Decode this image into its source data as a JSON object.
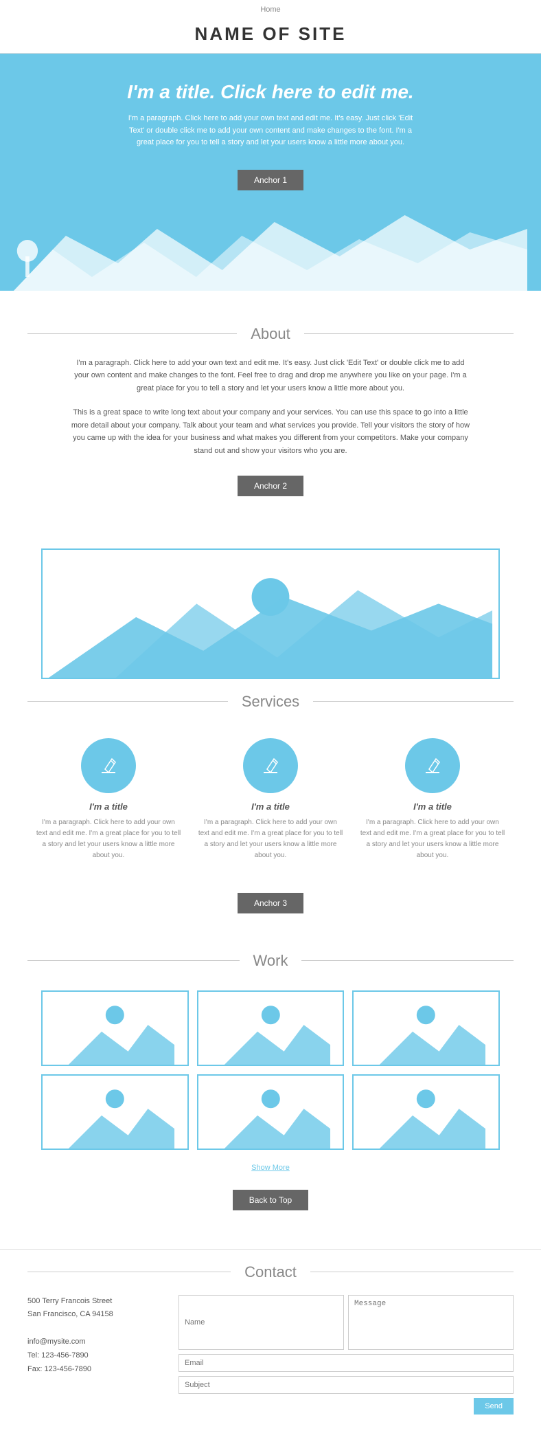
{
  "nav": {
    "home": "Home"
  },
  "header": {
    "title": "NAME OF SITE"
  },
  "hero": {
    "heading": "I'm a title. Click here to edit me.",
    "paragraph": "I'm a paragraph. Click here to add your own text and edit me. It's easy. Just click 'Edit Text' or double click me to add your own content and make changes to the font. I'm a great place for you to tell a story and let your users know a little more about you.",
    "button": "Anchor 1"
  },
  "about": {
    "section_title": "About",
    "paragraph1": "I'm a paragraph. Click here to add your own text and edit me. It's easy. Just click 'Edit Text' or double click me to add your own content and make changes to the font. Feel free to drag and drop me anywhere you like on your page. I'm a great place for you to tell a story and let your users know a little more about you.",
    "paragraph2": "This is a great space to write long text about your company and your services. You can use this space to go into a little more detail about your company. Talk about your team and what services you provide. Tell your visitors the story of how you came up with the idea for your business and what makes you different from your competitors. Make your company stand out and show your visitors who you are.",
    "button": "Anchor 2"
  },
  "services": {
    "section_title": "Services",
    "items": [
      {
        "title": "I'm a title",
        "paragraph": "I'm a paragraph. Click here to add your own text and edit me. I'm a great place for you to tell a story and let your users know a little more about you."
      },
      {
        "title": "I'm a title",
        "paragraph": "I'm a paragraph. Click here to add your own text and edit me. I'm a great place for you to tell a story and let your users know a little more about you."
      },
      {
        "title": "I'm a title",
        "paragraph": "I'm a paragraph. Click here to add your own text and edit me. I'm a great place for you to tell a story and let your users know a little more about you."
      }
    ],
    "button": "Anchor 3"
  },
  "work": {
    "section_title": "Work",
    "show_more": "Show More",
    "back_to_top": "Back to Top"
  },
  "contact": {
    "section_title": "Contact",
    "address_line1": "500 Terry Francois Street",
    "address_line2": "San Francisco, CA 94158",
    "email": "info@mysite.com",
    "tel": "Tel: 123-456-7890",
    "fax": "Fax: 123-456-7890",
    "form": {
      "name_placeholder": "Name",
      "email_placeholder": "Email",
      "subject_placeholder": "Subject",
      "message_placeholder": "Message",
      "submit_label": "Send"
    }
  }
}
